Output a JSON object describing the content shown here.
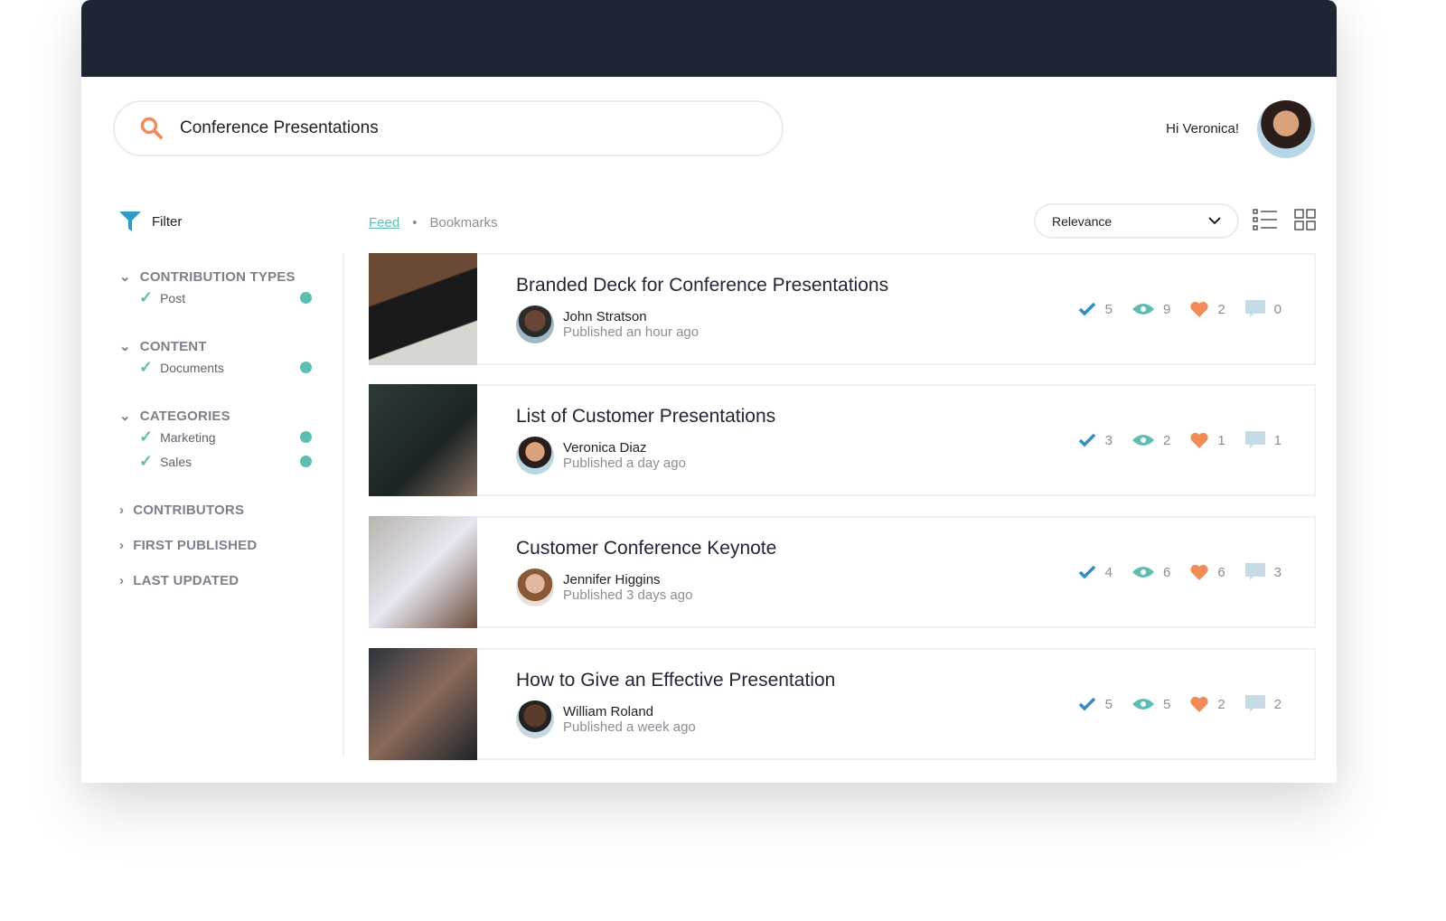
{
  "search": {
    "value": "Conference Presentations"
  },
  "user": {
    "greeting": "Hi Veronica!"
  },
  "filter": {
    "label": "Filter"
  },
  "sidebar": {
    "groups": [
      {
        "label": "CONTRIBUTION TYPES",
        "expanded": true,
        "options": [
          "Post"
        ]
      },
      {
        "label": "CONTENT",
        "expanded": true,
        "options": [
          "Documents"
        ]
      },
      {
        "label": "CATEGORIES",
        "expanded": true,
        "options": [
          "Marketing",
          "Sales"
        ]
      }
    ],
    "collapsed": [
      "CONTRIBUTORS",
      "FIRST PUBLISHED",
      "LAST UPDATED"
    ]
  },
  "tabs": {
    "feed": "Feed",
    "separator": "•",
    "bookmarks": "Bookmarks"
  },
  "sort": {
    "selected": "Relevance"
  },
  "colors": {
    "accent": "#5dbdb0",
    "header": "#1f2532",
    "check": "#2f8fc0",
    "heart": "#f08c5a",
    "comment": "#c5dbe6"
  },
  "posts": [
    {
      "title": "Branded Deck for Conference Presentations",
      "author": "John Stratson",
      "published": "Published an hour ago",
      "approvals": "5",
      "views": "9",
      "likes": "2",
      "comments": "0"
    },
    {
      "title": "List of Customer Presentations",
      "author": "Veronica Diaz",
      "published": "Published a day ago",
      "approvals": "3",
      "views": "2",
      "likes": "1",
      "comments": "1"
    },
    {
      "title": "Customer Conference Keynote",
      "author": "Jennifer Higgins",
      "published": "Published 3 days ago",
      "approvals": "4",
      "views": "6",
      "likes": "6",
      "comments": "3"
    },
    {
      "title": "How to Give an Effective Presentation",
      "author": "William Roland",
      "published": "Published a week ago",
      "approvals": "5",
      "views": "5",
      "likes": "2",
      "comments": "2"
    }
  ]
}
